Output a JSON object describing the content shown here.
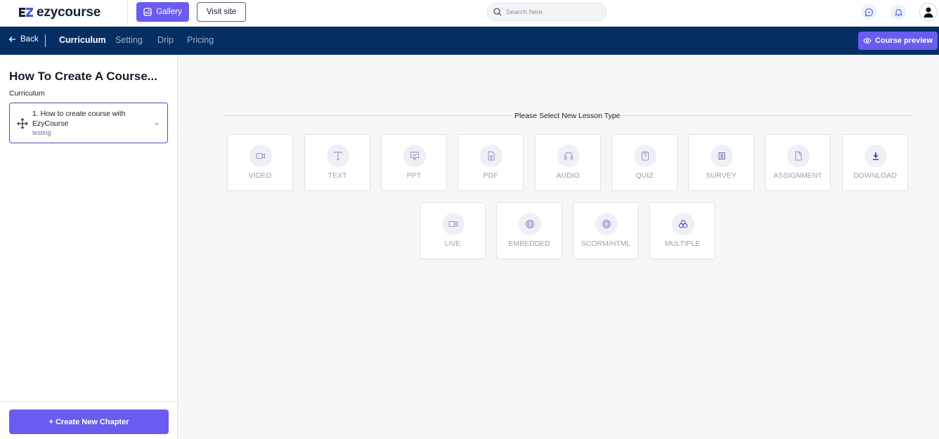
{
  "brand": {
    "logo_text": "ezycourse",
    "accent": "#6a5cf0",
    "navy": "#052e63"
  },
  "topbar": {
    "gallery_label": "Gallery",
    "visit_label": "Visit site",
    "search_placeholder": "Search here",
    "icons": [
      "chat-icon",
      "bell-icon",
      "user-avatar-icon"
    ]
  },
  "nav": {
    "back_label": "Back",
    "tabs": [
      {
        "label": "Curriculum",
        "active": true
      },
      {
        "label": "Setting",
        "active": false
      },
      {
        "label": "Drip",
        "active": false
      },
      {
        "label": "Pricing",
        "active": false
      }
    ],
    "preview_label": "Course preview"
  },
  "sidebar": {
    "course_title": "How To Create A Course...",
    "section_label": "Curriculum",
    "lessons": [
      {
        "title": "1. How to create course with EzyCourse",
        "subtitle": "testing"
      }
    ],
    "create_chapter_label": "+ Create New Chapter"
  },
  "main": {
    "select_label": "Please Select New Lesson Type",
    "lesson_types": [
      {
        "label": "VIDEO",
        "icon": "video-icon"
      },
      {
        "label": "TEXT",
        "icon": "text-icon"
      },
      {
        "label": "PPT",
        "icon": "presentation-icon"
      },
      {
        "label": "PDF",
        "icon": "document-icon"
      },
      {
        "label": "AUDIO",
        "icon": "headphones-icon"
      },
      {
        "label": "QUIZ",
        "icon": "clipboard-question-icon"
      },
      {
        "label": "SURVEY",
        "icon": "survey-icon"
      },
      {
        "label": "ASSIGNMENT",
        "icon": "file-icon"
      },
      {
        "label": "DOWNLOAD",
        "icon": "download-icon"
      },
      {
        "label": "LIVE",
        "icon": "live-video-icon"
      },
      {
        "label": "EMBEDDED",
        "icon": "globe-icon"
      },
      {
        "label": "SCORM/HTML",
        "icon": "globe-icon"
      },
      {
        "label": "MULTIPLE",
        "icon": "multiple-icon"
      }
    ]
  }
}
